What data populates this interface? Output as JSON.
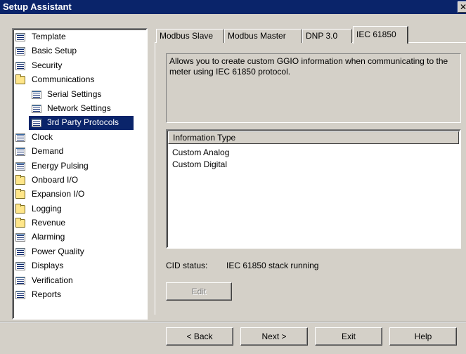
{
  "window": {
    "title": "Setup Assistant",
    "close_glyph": "✕"
  },
  "tree": {
    "items": [
      {
        "label": "Template",
        "icon": "document-icon",
        "level": 0
      },
      {
        "label": "Basic Setup",
        "icon": "document-icon",
        "level": 0
      },
      {
        "label": "Security",
        "icon": "document-icon",
        "level": 0
      },
      {
        "label": "Communications",
        "icon": "folder-icon",
        "level": 0
      },
      {
        "label": "Serial Settings",
        "icon": "document-icon",
        "level": 1
      },
      {
        "label": "Network Settings",
        "icon": "document-icon",
        "level": 1
      },
      {
        "label": "3rd Party Protocols",
        "icon": "document-icon",
        "level": 1,
        "selected": true
      },
      {
        "label": "Clock",
        "icon": "document-icon",
        "level": 0
      },
      {
        "label": "Demand",
        "icon": "document-icon",
        "level": 0
      },
      {
        "label": "Energy Pulsing",
        "icon": "document-icon",
        "level": 0
      },
      {
        "label": "Onboard I/O",
        "icon": "folder-icon",
        "level": 0
      },
      {
        "label": "Expansion I/O",
        "icon": "folder-icon",
        "level": 0
      },
      {
        "label": "Logging",
        "icon": "folder-icon",
        "level": 0
      },
      {
        "label": "Revenue",
        "icon": "folder-icon",
        "level": 0
      },
      {
        "label": "Alarming",
        "icon": "document-icon",
        "level": 0
      },
      {
        "label": "Power Quality",
        "icon": "document-icon",
        "level": 0
      },
      {
        "label": "Displays",
        "icon": "document-icon",
        "level": 0
      },
      {
        "label": "Verification",
        "icon": "document-icon",
        "level": 0
      },
      {
        "label": "Reports",
        "icon": "document-icon",
        "level": 0
      }
    ]
  },
  "tabs": [
    {
      "label": "Modbus Slave"
    },
    {
      "label": "Modbus Master"
    },
    {
      "label": "DNP 3.0"
    },
    {
      "label": "IEC 61850",
      "active": true
    }
  ],
  "panel": {
    "description": "Allows you to create custom GGIO information when communicating to the meter using IEC 61850 protocol.",
    "list": {
      "header": "Information Type",
      "rows": [
        "Custom Analog",
        "Custom Digital"
      ]
    },
    "cid_label": "CID status:",
    "cid_value": "IEC 61850 stack running",
    "edit_label": "Edit"
  },
  "footer": {
    "back_label": "< Back",
    "next_label": "Next >",
    "exit_label": "Exit",
    "help_label": "Help"
  },
  "colors": {
    "titlebar": "#0a246a",
    "selection": "#0a246a",
    "face": "#d4d0c8"
  }
}
